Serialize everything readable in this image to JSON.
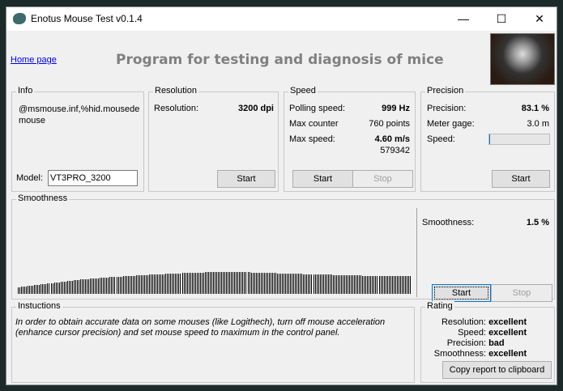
{
  "window": {
    "title": "Enotus Mouse Test v0.1.4",
    "minimize": "—",
    "maximize": "☐",
    "close": "✕"
  },
  "header": {
    "home_link": "Home page",
    "title": "Program for testing and diagnosis of mice"
  },
  "info": {
    "legend": "Info",
    "device": "@msmouse.inf,%hid.mousede mouse",
    "model_label": "Model:",
    "model_value": "VT3PRO_3200"
  },
  "resolution": {
    "legend": "Resolution",
    "label": "Resolution:",
    "value": "3200 dpi",
    "start": "Start"
  },
  "speed": {
    "legend": "Speed",
    "polling_label": "Polling speed:",
    "polling_value": "999 Hz",
    "counter_label": "Max counter",
    "counter_value": "760 points",
    "max_label": "Max  speed:",
    "max_value": "4.60 m/s",
    "max_raw": "579342",
    "start": "Start",
    "stop": "Stop"
  },
  "precision": {
    "legend": "Precision",
    "label": "Precision:",
    "value": "83.1 %",
    "gage_label": "Meter gage:",
    "gage_value": "3.0 m",
    "speed_label": "Speed:",
    "speed_fill": 0.02,
    "start": "Start"
  },
  "smoothness": {
    "legend": "Smoothness",
    "label": "Smoothness:",
    "value": "1.5 %",
    "start": "Start",
    "stop": "Stop"
  },
  "instructions": {
    "legend": "Instuctions",
    "text": "In order to obtain accurate data on some mouses (like Logithech), turn off mouse acceleration (enhance cursor precision) and set mouse speed to maximum in the control panel."
  },
  "rating": {
    "legend": "Rating",
    "items": [
      {
        "label": "Resolution:",
        "value": "excellent"
      },
      {
        "label": "Speed:",
        "value": "excellent"
      },
      {
        "label": "Precision:",
        "value": "bad"
      },
      {
        "label": "Smoothness:",
        "value": "excellent"
      }
    ],
    "copy": "Copy report to clipboard"
  },
  "chart_data": {
    "type": "bar",
    "title": "Smoothness",
    "values": [
      8,
      9,
      9,
      10,
      10,
      11,
      11,
      12,
      12,
      13,
      13,
      14,
      14,
      15,
      15,
      16,
      16,
      17,
      17,
      18,
      18,
      18,
      19,
      19,
      19,
      20,
      20,
      20,
      21,
      21,
      21,
      21,
      22,
      22,
      22,
      22,
      23,
      23,
      23,
      23,
      24,
      24,
      24,
      24,
      24,
      25,
      25,
      25,
      25,
      25,
      26,
      26,
      26,
      26,
      26,
      26,
      26,
      27,
      27,
      27,
      27,
      27,
      27,
      27,
      27,
      27,
      27,
      27,
      27,
      27,
      27,
      26,
      26,
      26,
      26,
      26,
      26,
      26,
      26,
      25,
      25,
      25,
      25,
      25,
      25,
      25,
      25,
      24,
      24,
      24,
      24,
      24,
      24,
      24,
      24,
      24,
      23,
      23,
      23,
      23,
      23,
      23,
      23,
      23,
      23,
      22,
      22,
      22,
      22,
      22,
      22,
      22,
      22,
      22,
      22,
      22,
      22,
      22,
      22,
      22
    ]
  }
}
